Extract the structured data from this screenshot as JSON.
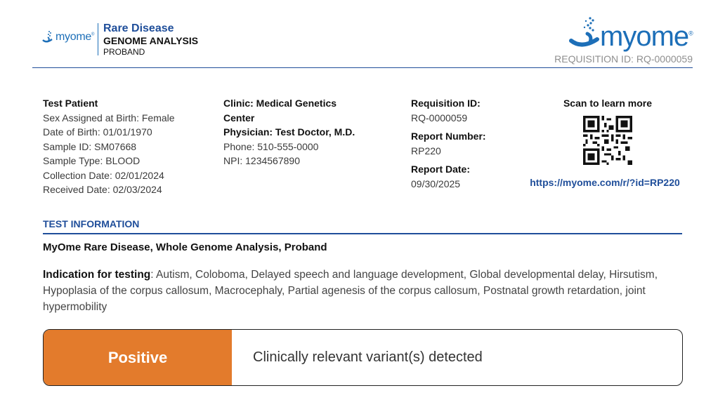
{
  "header": {
    "small_logo_text": "myome",
    "small_logo_reg": "®",
    "title_line1": "Rare Disease",
    "title_line2": "GENOME ANALYSIS",
    "title_line3": "PROBAND",
    "big_logo_text": "myome",
    "big_logo_reg": "®",
    "requisition_header": "REQUISITION ID: RQ-0000059"
  },
  "patient": {
    "name": "Test Patient",
    "sex": "Sex Assigned at Birth: Female",
    "dob": "Date of Birth: 01/01/1970",
    "sample_id": "Sample ID: SM07668",
    "sample_type": "Sample Type: BLOOD",
    "collection_date": "Collection Date: 02/01/2024",
    "received_date": "Received Date: 02/03/2024"
  },
  "clinic": {
    "clinic": "Clinic: Medical Genetics Center",
    "physician": "Physician: Test Doctor, M.D.",
    "phone": "Phone: 510-555-0000",
    "npi": "NPI: 1234567890"
  },
  "report": {
    "requisition_label": "Requisition ID:",
    "requisition_value": "RQ-0000059",
    "report_number_label": "Report Number:",
    "report_number_value": "RP220",
    "report_date_label": "Report Date:",
    "report_date_value": "09/30/2025"
  },
  "qr": {
    "title": "Scan to learn more",
    "url": "https://myome.com/r/?id=RP220"
  },
  "test_info": {
    "section_title": "TEST INFORMATION",
    "test_name": "MyOme Rare Disease, Whole Genome Analysis, Proband",
    "indication_label": "Indication for testing",
    "indication_text": ": Autism, Coloboma, Delayed speech and language development, Global developmental delay, Hirsutism, Hypoplasia of the corpus callosum, Macrocephaly, Partial agenesis of the corpus callosum, Postnatal growth retardation, joint hypermobility"
  },
  "result": {
    "status": "Positive",
    "description": "Clinically relevant variant(s) detected",
    "status_color": "#e37b2c"
  },
  "colors": {
    "brand_blue": "#1d6fb8",
    "navy": "#1f4e9a"
  }
}
